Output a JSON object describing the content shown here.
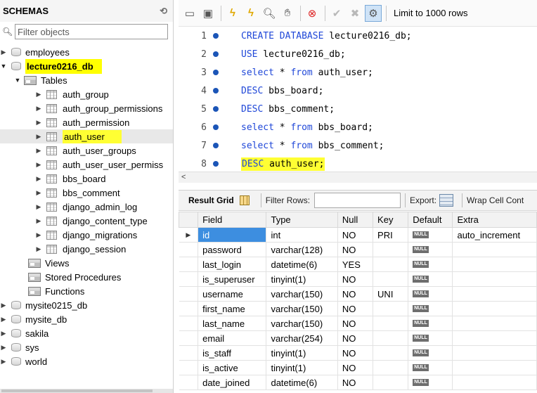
{
  "schemas_panel": {
    "title": "SCHEMAS",
    "filter_placeholder": "Filter objects",
    "schemas": [
      {
        "name": "employees"
      },
      {
        "name": "lecture0216_db"
      }
    ],
    "tables_label": "Tables",
    "tables": [
      "auth_group",
      "auth_group_permissions",
      "auth_permission",
      "auth_user",
      "auth_user_groups",
      "auth_user_user_permiss",
      "bbs_board",
      "bbs_comment",
      "django_admin_log",
      "django_content_type",
      "django_migrations",
      "django_session"
    ],
    "views_label": "Views",
    "stored_procedures_label": "Stored Procedures",
    "functions_label": "Functions",
    "other_schemas": [
      "mysite0215_db",
      "mysite_db",
      "sakila",
      "sys",
      "world"
    ]
  },
  "toolbar": {
    "limit_label": "Limit to 1000 rows"
  },
  "editor": {
    "lines": [
      {
        "num": "1",
        "kw": "CREATE DATABASE",
        "rest": " lecture0216_db;"
      },
      {
        "num": "2",
        "kw": "USE",
        "rest": " lecture0216_db;"
      },
      {
        "num": "3",
        "kw": "select",
        "mid": " * ",
        "kw2": "from",
        "rest": " auth_user;"
      },
      {
        "num": "4",
        "kw": "DESC",
        "rest": " bbs_board;"
      },
      {
        "num": "5",
        "kw": "DESC",
        "rest": " bbs_comment;"
      },
      {
        "num": "6",
        "kw": "select",
        "mid": " * ",
        "kw2": "from",
        "rest": " bbs_board;"
      },
      {
        "num": "7",
        "kw": "select",
        "mid": " * ",
        "kw2": "from",
        "rest": " bbs_comment;"
      },
      {
        "num": "8",
        "kw": "DESC",
        "rest": " auth_user;"
      }
    ]
  },
  "results": {
    "result_grid_label": "Result Grid",
    "filter_rows_label": "Filter Rows:",
    "export_label": "Export:",
    "wrap_label": "Wrap Cell Cont",
    "null_badge": "NULL",
    "columns": [
      "Field",
      "Type",
      "Null",
      "Key",
      "Default",
      "Extra"
    ],
    "rows": [
      {
        "field": "id",
        "type": "int",
        "null": "NO",
        "key": "PRI",
        "extra": "auto_increment"
      },
      {
        "field": "password",
        "type": "varchar(128)",
        "null": "NO",
        "key": "",
        "extra": ""
      },
      {
        "field": "last_login",
        "type": "datetime(6)",
        "null": "YES",
        "key": "",
        "extra": ""
      },
      {
        "field": "is_superuser",
        "type": "tinyint(1)",
        "null": "NO",
        "key": "",
        "extra": ""
      },
      {
        "field": "username",
        "type": "varchar(150)",
        "null": "NO",
        "key": "UNI",
        "extra": ""
      },
      {
        "field": "first_name",
        "type": "varchar(150)",
        "null": "NO",
        "key": "",
        "extra": ""
      },
      {
        "field": "last_name",
        "type": "varchar(150)",
        "null": "NO",
        "key": "",
        "extra": ""
      },
      {
        "field": "email",
        "type": "varchar(254)",
        "null": "NO",
        "key": "",
        "extra": ""
      },
      {
        "field": "is_staff",
        "type": "tinyint(1)",
        "null": "NO",
        "key": "",
        "extra": ""
      },
      {
        "field": "is_active",
        "type": "tinyint(1)",
        "null": "NO",
        "key": "",
        "extra": ""
      },
      {
        "field": "date_joined",
        "type": "datetime(6)",
        "null": "NO",
        "key": "",
        "extra": ""
      }
    ]
  },
  "colors": {
    "highlight": "#ffff00",
    "keyword": "#1f47d8",
    "line_marker": "#1b55b7",
    "selected_cell": "#3d8ee0"
  }
}
